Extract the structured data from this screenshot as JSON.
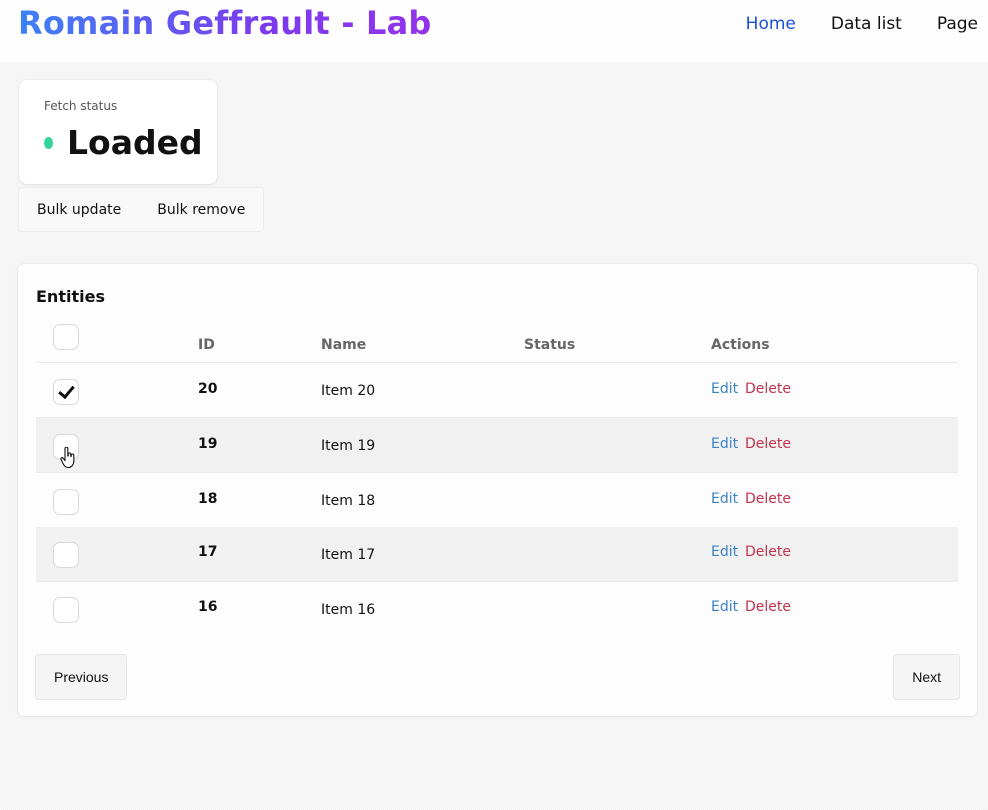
{
  "header": {
    "brand": "Romain Geffrault - Lab",
    "nav": [
      "Home",
      "Data list",
      "Page"
    ]
  },
  "status": {
    "label": "Fetch status",
    "value": "Loaded",
    "color": "#34d399"
  },
  "bulk": {
    "update_label": "Bulk update",
    "remove_label": "Bulk remove"
  },
  "table": {
    "title": "Entities",
    "columns": [
      "ID",
      "Name",
      "Status",
      "Actions"
    ],
    "rows": [
      {
        "id": "20",
        "name": "Item 20",
        "status": "",
        "checked": true,
        "edit": "Edit",
        "delete": "Delete"
      },
      {
        "id": "19",
        "name": "Item 19",
        "status": "",
        "checked": false,
        "edit": "Edit",
        "delete": "Delete"
      },
      {
        "id": "18",
        "name": "Item 18",
        "status": "",
        "checked": false,
        "edit": "Edit",
        "delete": "Delete"
      },
      {
        "id": "17",
        "name": "Item 17",
        "status": "",
        "checked": false,
        "edit": "Edit",
        "delete": "Delete"
      },
      {
        "id": "16",
        "name": "Item 16",
        "status": "",
        "checked": false,
        "edit": "Edit",
        "delete": "Delete"
      }
    ]
  },
  "pager": {
    "prev_label": "Previous",
    "next_label": "Next"
  },
  "colors": {
    "nav_active": "#1d4ed8",
    "edit": "#3b82c4",
    "delete": "#c2334d"
  }
}
